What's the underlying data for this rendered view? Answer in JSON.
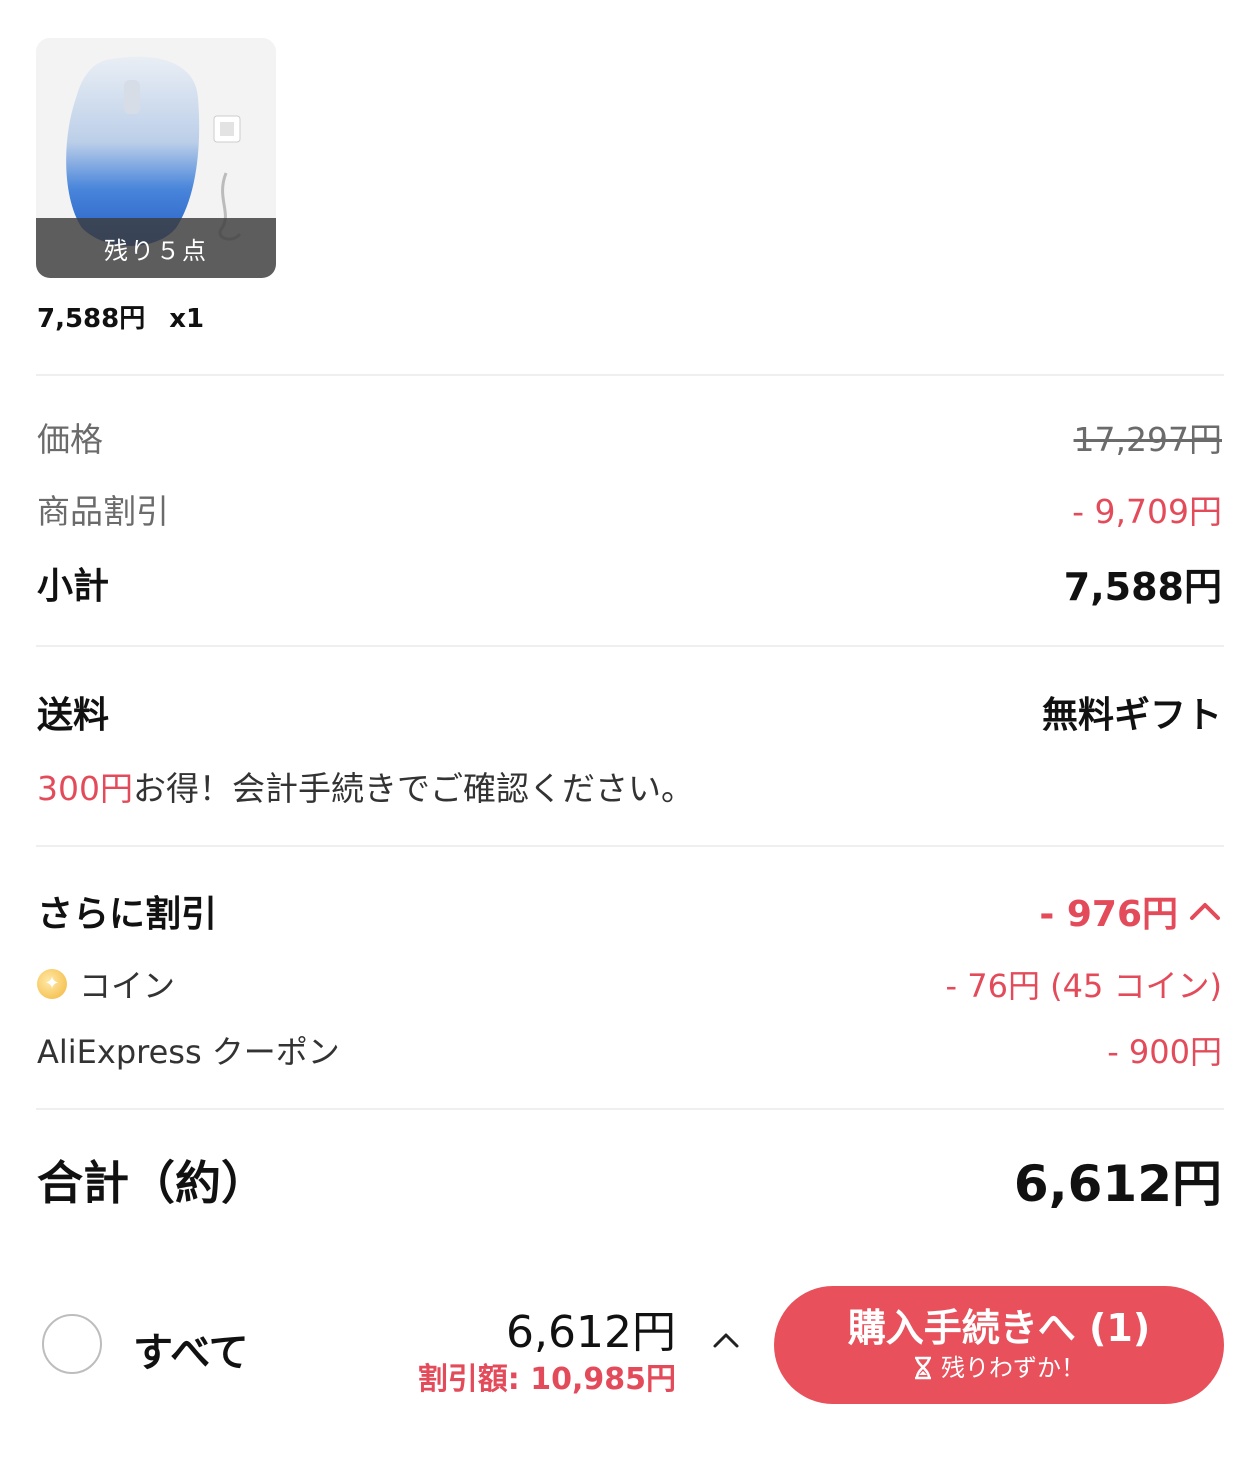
{
  "product": {
    "stock_badge": "残り５点",
    "unit_price": "7,588円",
    "quantity": "x1"
  },
  "summary": {
    "price_label": "価格",
    "price_value": "17,297円",
    "discount_label": "商品割引",
    "discount_value": "- 9,709円",
    "subtotal_label": "小計",
    "subtotal_value": "7,588円"
  },
  "shipping": {
    "label": "送料",
    "value": "無料ギフト",
    "note_highlight": "300円",
    "note_text": "お得！会計手続きでご確認ください。"
  },
  "extra_discount": {
    "label": "さらに割引",
    "value": "- 976円",
    "coin_label": "コイン",
    "coin_value": "- 76円 (45 コイン)",
    "coupon_label": "AliExpress クーポン",
    "coupon_value": "- 900円"
  },
  "total": {
    "label": "合計（約）",
    "value": "6,612円"
  },
  "bottom_bar": {
    "select_all_label": "すべて",
    "total": "6,612円",
    "discount": "割引額: 10,985円",
    "checkout_label": "購入手続きへ (1)",
    "checkout_sub": "残りわずか！"
  },
  "colors": {
    "accent_red": "#e34b5a",
    "button_red": "#e8505b"
  },
  "icons": [
    "coin-icon",
    "chevron-up-icon",
    "hourglass-icon"
  ]
}
